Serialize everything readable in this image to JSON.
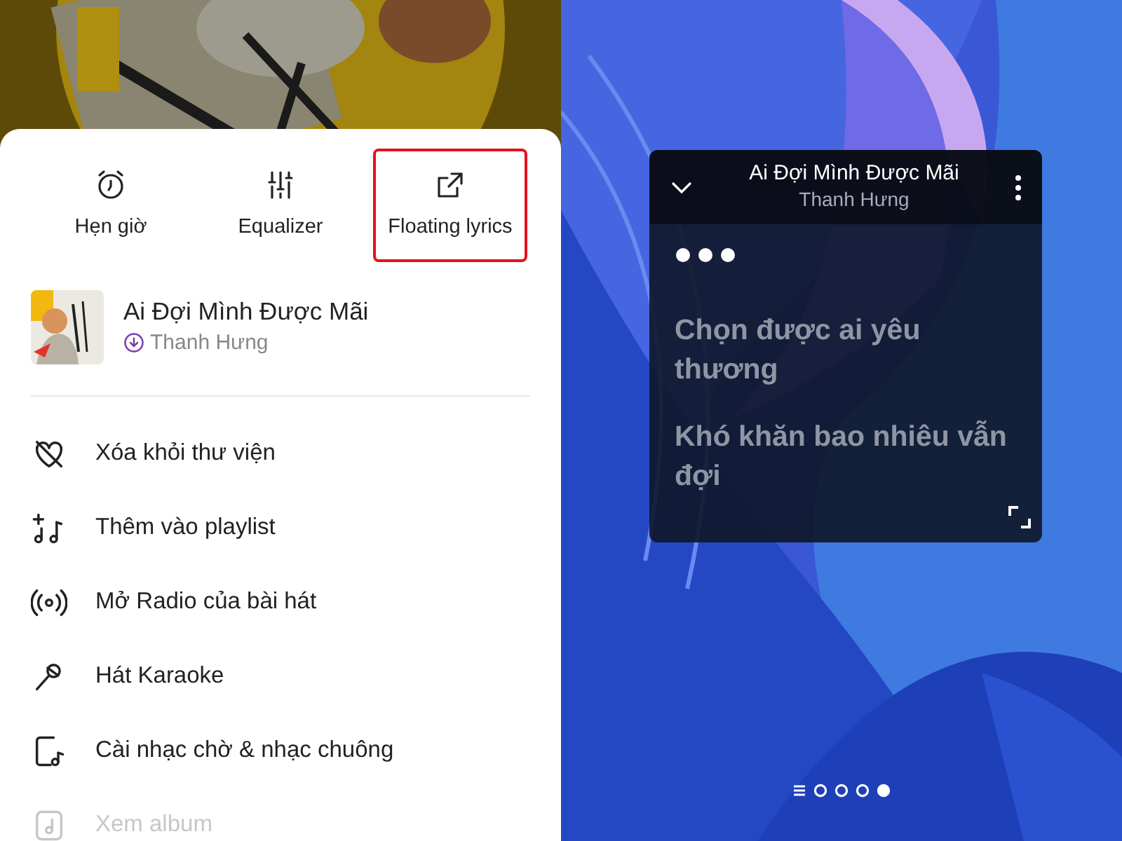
{
  "actions": [
    {
      "kind": "alarm",
      "label": "Hẹn giờ",
      "highlighted": false
    },
    {
      "kind": "equalizer",
      "label": "Equalizer",
      "highlighted": false
    },
    {
      "kind": "external",
      "label": "Floating lyrics",
      "highlighted": true
    }
  ],
  "song": {
    "title": "Ai Đợi Mình Được Mãi",
    "artist": "Thanh Hưng",
    "downloaded": true
  },
  "menu": [
    {
      "kind": "heart-off",
      "label": "Xóa khỏi thư viện",
      "dimmed": false
    },
    {
      "kind": "playlist-add",
      "label": "Thêm vào playlist",
      "dimmed": false
    },
    {
      "kind": "radio",
      "label": "Mở Radio của bài hát",
      "dimmed": false
    },
    {
      "kind": "mic",
      "label": "Hát Karaoke",
      "dimmed": false
    },
    {
      "kind": "phone-music",
      "label": "Cài nhạc chờ & nhạc chuông",
      "dimmed": false
    },
    {
      "kind": "album",
      "label": "Xem album",
      "dimmed": true
    }
  ],
  "floating_lyrics": {
    "title": "Ai Đợi Mình Được Mãi",
    "artist": "Thanh Hưng",
    "lines": [
      {
        "text": "Chọn được ai yêu thương"
      },
      {
        "text": "Khó khăn bao nhiêu vẫn đợi"
      }
    ]
  },
  "page_indicator": [
    {
      "kind": "list"
    },
    {
      "kind": "dot",
      "selected": false
    },
    {
      "kind": "dot",
      "selected": false
    },
    {
      "kind": "dot",
      "selected": false
    },
    {
      "kind": "dot",
      "selected": true
    }
  ]
}
